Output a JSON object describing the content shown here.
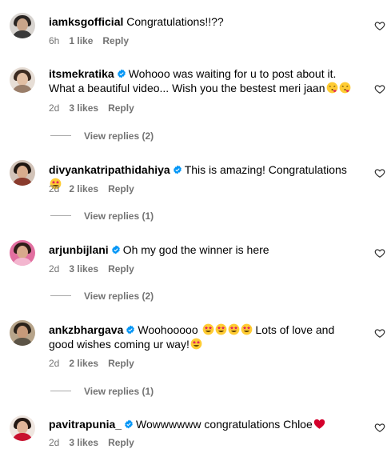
{
  "comments": [
    {
      "username": "iamksgofficial",
      "verified": false,
      "text": " Congratulations!!??",
      "emojis": [],
      "time": "6h",
      "likes": "1 like",
      "reply": "Reply",
      "view_replies": null
    },
    {
      "username": "itsmekratika",
      "verified": true,
      "text": "Wohooo was waiting for u to post about it. What a beautiful video... Wish you the bestest meri jaan",
      "emojis": [
        "face-blowing-kiss",
        "face-blowing-kiss"
      ],
      "time": "2d",
      "likes": "3 likes",
      "reply": "Reply",
      "view_replies": "View replies (2)"
    },
    {
      "username": "divyankatripathidahiya",
      "verified": true,
      "text": "This is amazing! Congratulations ",
      "emojis": [
        "star-struck"
      ],
      "time": "2d",
      "likes": "2 likes",
      "reply": "Reply",
      "view_replies": "View replies (1)"
    },
    {
      "username": "arjunbijlani",
      "verified": true,
      "text": "Oh my god the winner is here",
      "emojis": [],
      "time": "2d",
      "likes": "3 likes",
      "reply": "Reply",
      "view_replies": "View replies (2)"
    },
    {
      "username": "ankzbhargava",
      "verified": true,
      "text_before": "Woohooooo ",
      "text_middle": " Lots of love and good wishes coming ur way!",
      "emojis": [
        "star-struck",
        "star-struck",
        "star-struck",
        "star-struck",
        "star-struck"
      ],
      "time": "2d",
      "likes": "2 likes",
      "reply": "Reply",
      "view_replies": "View replies (1)"
    },
    {
      "username": "pavitrapunia_",
      "verified": true,
      "text": "Wowwwwww congratulations Chloe",
      "emojis": [
        "red-heart"
      ],
      "time": "2d",
      "likes": "3 likes",
      "reply": "Reply",
      "view_replies": null
    }
  ],
  "colors": {
    "verified_blue": "#0095f6",
    "meta_gray": "#737373",
    "star_struck_yellow": "#ffcc33",
    "heart_red": "#e0245e"
  }
}
